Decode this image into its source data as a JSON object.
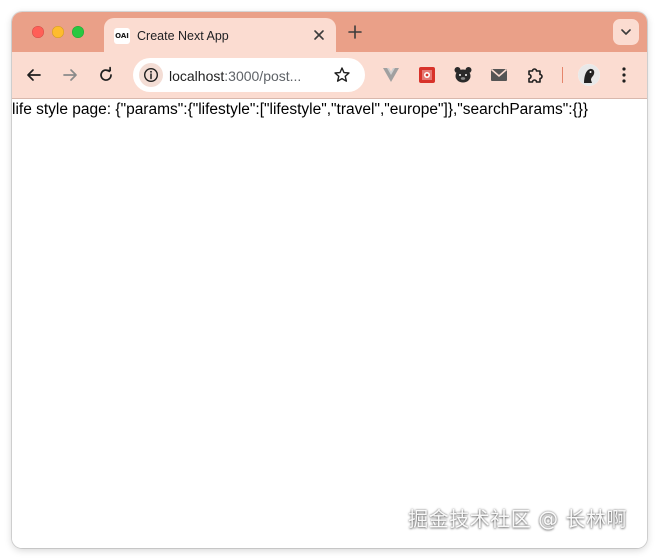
{
  "browser": {
    "tab": {
      "favicon_text": "OAI",
      "title": "Create Next App"
    },
    "address_bar": {
      "host": "localhost",
      "rest": ":3000/post..."
    }
  },
  "page": {
    "text": "life style page: {\"params\":{\"lifestyle\":[\"lifestyle\",\"travel\",\"europe\"]},\"searchParams\":{}}"
  },
  "watermark": {
    "text": "掘金技术社区 @ 长林啊"
  },
  "colors": {
    "tabstrip": "#eaa088",
    "toolbar": "#fbdcd1",
    "close_red": "#ff5f57",
    "minimize_yellow": "#febc2e",
    "zoom_green": "#28c840"
  },
  "icons": [
    "back-arrow-icon",
    "forward-arrow-icon",
    "reload-icon",
    "info-icon",
    "star-icon",
    "close-icon",
    "plus-icon",
    "chevron-down-icon",
    "puzzle-icon",
    "kebab-menu-icon"
  ]
}
